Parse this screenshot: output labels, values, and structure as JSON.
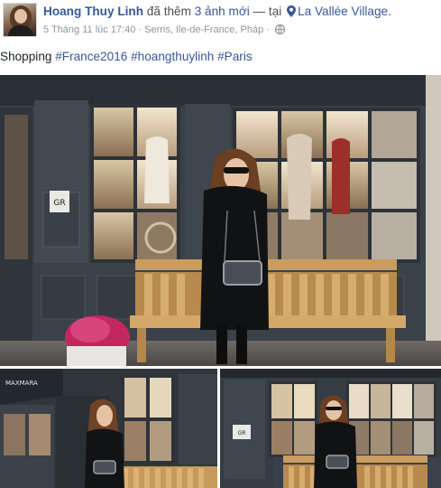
{
  "post": {
    "author": "Hoang Thuy Linh",
    "action": "đã thêm",
    "photo_count_text": "3 ảnh mới",
    "separator": "— tại",
    "location": "La Vallée Village",
    "location_suffix": ".",
    "timestamp": "5 Tháng 11 lúc 17:40",
    "place_detail": "Serris, Ile-de-France, Pháp",
    "meta_dot": "·",
    "audience_icon": "globe-icon",
    "caption_prefix": "Shopping",
    "hashtags": [
      "#France2016",
      "#hoangthuylinh",
      "#Paris"
    ]
  },
  "photos": [
    {
      "name": "main-photo",
      "shop_sign": "GR"
    },
    {
      "name": "left-photo",
      "shop_sign": "MAXMARA"
    },
    {
      "name": "right-photo",
      "shop_sign": "GR"
    }
  ],
  "colors": {
    "link": "#365899",
    "meta": "#90949c",
    "text": "#1d2129"
  }
}
